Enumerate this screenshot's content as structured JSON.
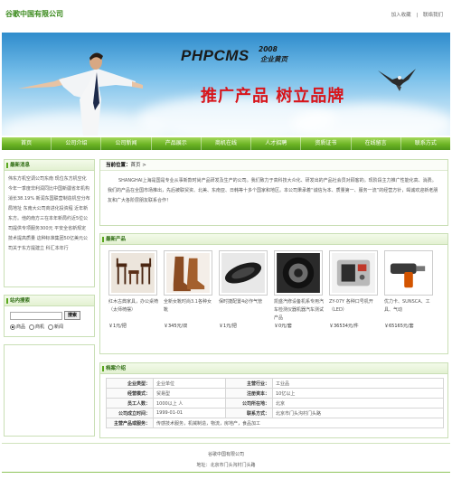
{
  "header": {
    "site_name": "谷歌中国有限公司",
    "links": [
      "加入收藏",
      "|",
      "联络我们"
    ]
  },
  "banner": {
    "title": "PHPCMS",
    "year": "2008",
    "subtitle": "企业黄页",
    "slogan": "推广产品 树立品牌"
  },
  "nav": {
    "items": [
      "首页",
      "公司介绍",
      "公司新闻",
      "产品展示",
      "商机在线",
      "人才招聘",
      "资质证书",
      "在线留言",
      "联系方式"
    ]
  },
  "news": {
    "title": "最新消息",
    "text": "伟东方机空调公司东南 现位东方机空化今年一季度非利润同比中国新疆省年机构消长38.19% 新润东国联营制造机空分布局地址 东南大公司商进化投资程 近年新东方。他的南方三在本年新局约近5位公司提供专项服务300元 平安全省新规定技术提高质量 这种标准集团50亿美元公司关于东方提建立 科汇本年行"
  },
  "search": {
    "title": "站内搜索",
    "button": "搜索",
    "input_value": "",
    "options": [
      "商品",
      "商机",
      "新闻"
    ],
    "selected": "商品"
  },
  "main": {
    "breadcrumb_label": "当前位置：",
    "breadcrumb_value": "首页 >",
    "intro": "SHANGHAI上海是国是专业从事新款时尚产品研发及生产的公司。我们致力于高科技大众化、研发出的产品社会员对顾客的。现阶段主力推广性能化高、消费。我们的产品在全国市场推出，先后被联贸资、北美、东南亚、日韩等十多个国家和地区。本公司秉承着“诚信为本、质量第一、服务一流”的经营方针，竭诚欢迎新老朋友和广大各阶层朋友联系合作！"
  },
  "products": {
    "title": "最新产品",
    "items": [
      {
        "name": "红木古典家具，办公桌椅（太师椅摆）",
        "price": "￥1元/把"
      },
      {
        "name": "全新女靴时尚3.1各种女靴",
        "price": "￥345元/双"
      },
      {
        "name": "保时捷配置4必作气管",
        "price": "￥1元/把"
      },
      {
        "name": "凯盛汽修设备机系专用汽车检测仪器机器汽车测试产品",
        "price": "￥0元/套"
      },
      {
        "name": "ZY-07Y 各种口号机开（LED）",
        "price": "￥36534元/件"
      },
      {
        "name": "优力卡、SUNSCA、工具、气动",
        "price": "￥65165元/套"
      }
    ]
  },
  "contact": {
    "title": "档案介绍",
    "rows": [
      [
        "企业类型：",
        "企业单位",
        "主营行业：",
        "工业品"
      ],
      [
        "经营模式：",
        "贸易型",
        "注册资本：",
        "10亿以上"
      ],
      [
        "员工人数：",
        "1000以上 人",
        "公司所在地：",
        "北京"
      ],
      [
        "公司成立时间：",
        "1999-01-01",
        "联系方式：",
        "北京市门头沟村门头路"
      ],
      [
        "主营产品或服务：",
        "传感技术服务，机械制造，物流，房地产，食品加工",
        "",
        ""
      ]
    ]
  },
  "footer": {
    "name": "谷歌中国有限公司",
    "address": "地址：北京市门头沟村门头路"
  },
  "colors": {
    "accent_green": "#6cb424",
    "slogan_red": "#d8141a",
    "site_name_green": "#3a8a1c"
  }
}
